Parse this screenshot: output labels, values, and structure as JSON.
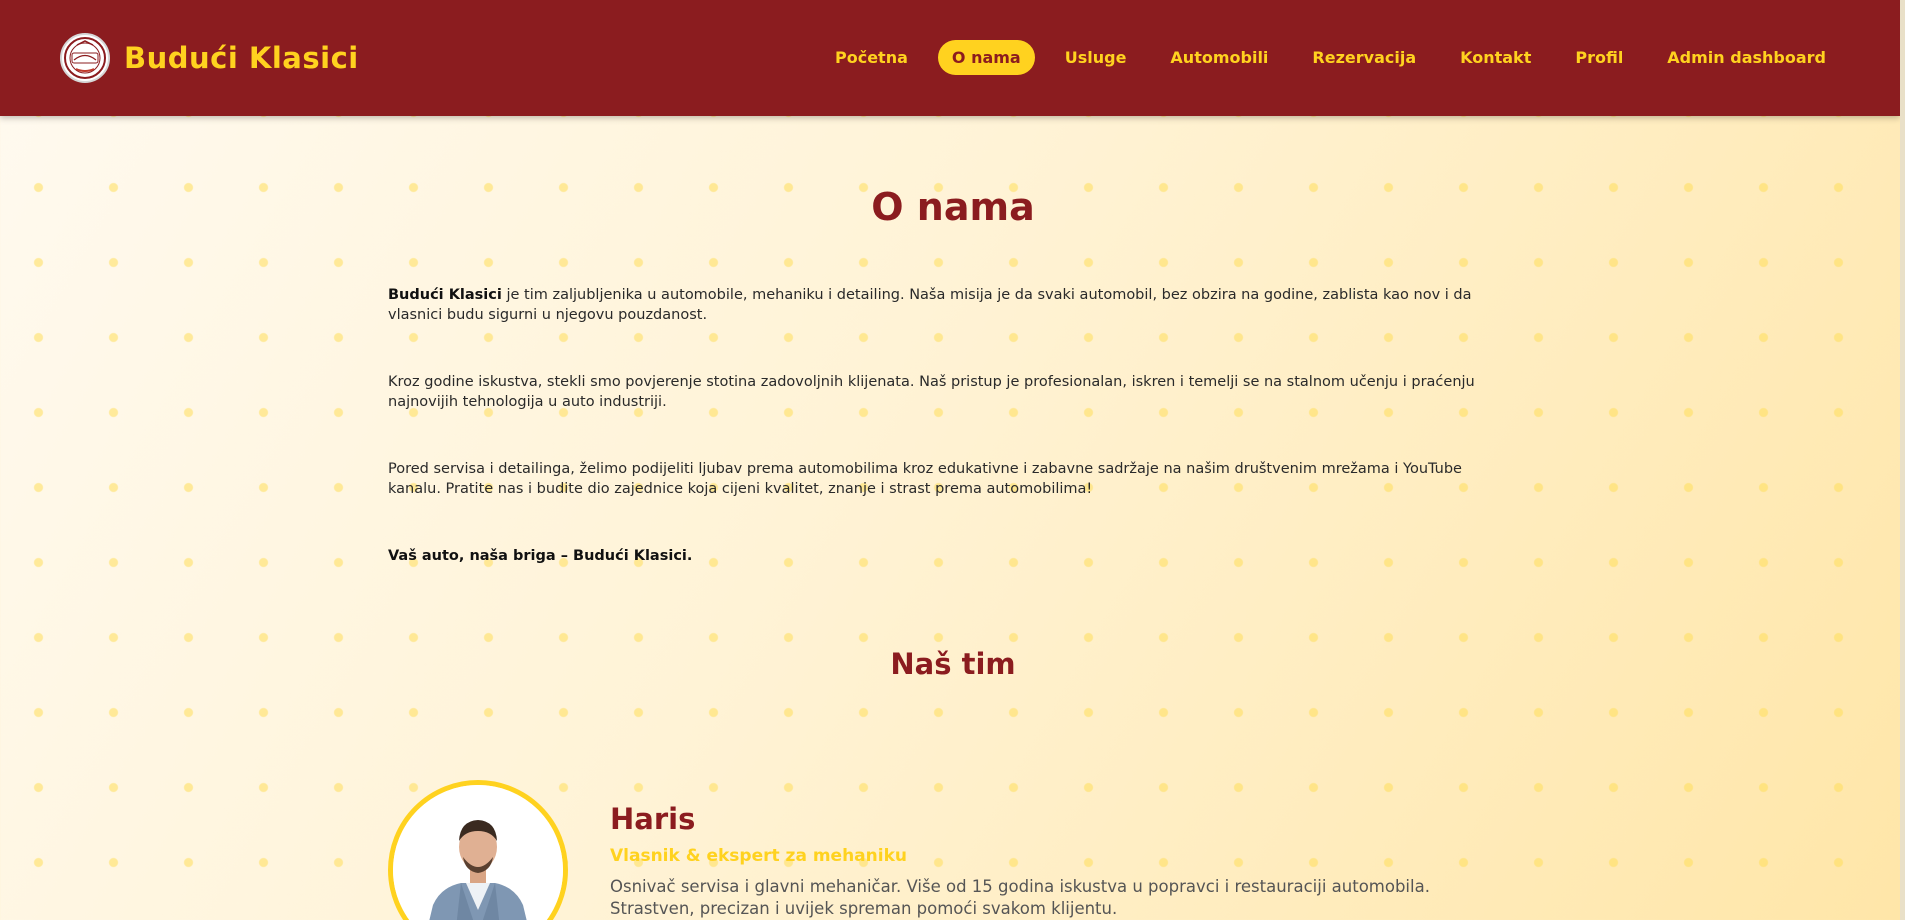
{
  "brand": {
    "name": "Budući Klasici",
    "logo_text": "Budući Klasici"
  },
  "nav": {
    "items": [
      {
        "label": "Početna"
      },
      {
        "label": "O nama"
      },
      {
        "label": "Usluge"
      },
      {
        "label": "Automobili"
      },
      {
        "label": "Rezervacija"
      },
      {
        "label": "Kontakt"
      },
      {
        "label": "Profil"
      },
      {
        "label": "Admin dashboard"
      }
    ],
    "active": "O nama"
  },
  "about": {
    "title": "O nama",
    "p1_bold": "Budući Klasici",
    "p1_rest": " je tim zaljubljenika u automobile, mehaniku i detailing. Naša misija je da svaki automobil, bez obzira na godine, zablista kao nov i da vlasnici budu sigurni u njegovu pouzdanost.",
    "p2": "Kroz godine iskustva, stekli smo povjerenje stotina zadovoljnih klijenata. Naš pristup je profesionalan, iskren i temelji se na stalnom učenju i praćenju najnovijih tehnologija u auto industriji.",
    "p3": "Pored servisa i detailinga, želimo podijeliti ljubav prema automobilima kroz edukativne i zabavne sadržaje na našim društvenim mrežama i YouTube kanalu. Pratite nas i budite dio zajednice koja cijeni kvalitet, znanje i strast prema automobilima!",
    "p4": "Vaš auto, naša briga – Budući Klasici."
  },
  "team": {
    "title": "Naš tim",
    "members": [
      {
        "name": "Haris",
        "role": "Vlasnik & ekspert za mehaniku",
        "description": "Osnivač servisa i glavni mehaničar. Više od 15 godina iskustva u popravci i restauraciji automobila. Strastven, precizan i uvijek spreman pomoći svakom klijentu."
      }
    ]
  },
  "colors": {
    "header_bg": "#8b1c1f",
    "accent_yellow": "#ffd21f",
    "heading_red": "#8b1c1f"
  }
}
